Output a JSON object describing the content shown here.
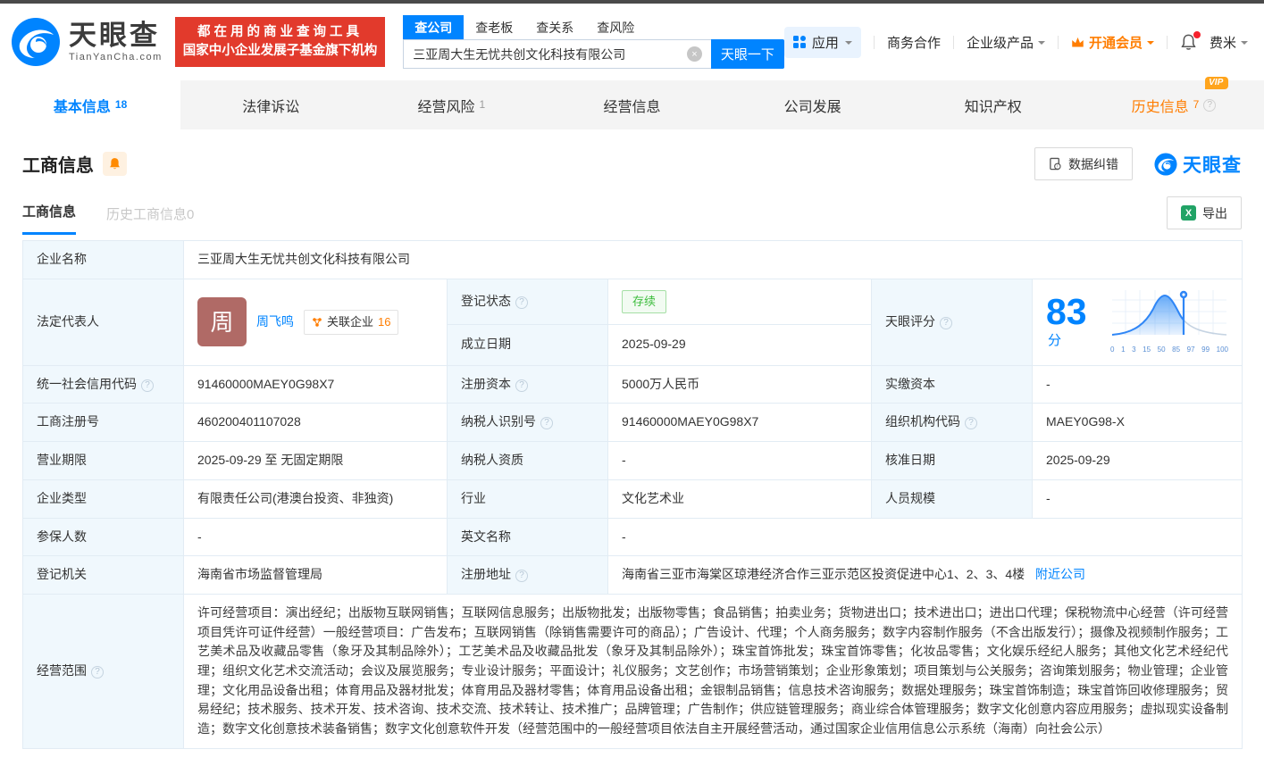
{
  "colors": {
    "primary": "#0084ff",
    "orange": "#ff7d00",
    "red": "#e23a2c",
    "green": "#3dbd3d"
  },
  "header": {
    "logo_title": "天眼查",
    "logo_subtitle": "TianYanCha.com",
    "slogan_line1": "都在用的商业查询工具",
    "slogan_line2": "国家中小企业发展子基金旗下机构",
    "search_tabs": [
      {
        "label": "查公司"
      },
      {
        "label": "查老板"
      },
      {
        "label": "查关系"
      },
      {
        "label": "查风险"
      }
    ],
    "search_value": "三亚周大生无忧共创文化科技有限公司",
    "search_button": "天眼一下",
    "nav_apps": "应用",
    "nav_cooperation": "商务合作",
    "nav_enterprise": "企业级产品",
    "nav_vip": "开通会员",
    "nav_user": "费米"
  },
  "nav_tabs": [
    {
      "label": "基本信息",
      "count": "18"
    },
    {
      "label": "法律诉讼",
      "count": ""
    },
    {
      "label": "经营风险",
      "count": "1"
    },
    {
      "label": "经营信息",
      "count": ""
    },
    {
      "label": "公司发展",
      "count": ""
    },
    {
      "label": "知识产权",
      "count": ""
    },
    {
      "label": "历史信息",
      "count": "7",
      "vip_badge": "VIP"
    }
  ],
  "section": {
    "title": "工商信息",
    "data_correction": "数据纠错",
    "watermark": "天眼查",
    "subtabs": [
      {
        "label": "工商信息"
      },
      {
        "label": "历史工商信息0"
      }
    ],
    "export": "导出"
  },
  "table": {
    "company_name": {
      "label": "企业名称",
      "value": "三亚周大生无忧共创文化科技有限公司"
    },
    "legal_rep": {
      "label": "法定代表人",
      "avatar": "周",
      "name": "周飞鸣",
      "related_label": "关联企业",
      "related_count": "16"
    },
    "reg_status": {
      "label": "登记状态",
      "value": "存续"
    },
    "establish_date": {
      "label": "成立日期",
      "value": "2025-09-29"
    },
    "score": {
      "label": "天眼评分",
      "value": "83",
      "unit": "分",
      "axis": [
        "0",
        "1",
        "3",
        "15",
        "50",
        "85",
        "97",
        "99",
        "100"
      ]
    },
    "credit_code": {
      "label": "统一社会信用代码",
      "value": "91460000MAEY0G98X7"
    },
    "reg_capital": {
      "label": "注册资本",
      "value": "5000万人民币"
    },
    "paid_capital": {
      "label": "实缴资本",
      "value": "-"
    },
    "reg_number": {
      "label": "工商注册号",
      "value": "460200401107028"
    },
    "taxpayer_id": {
      "label": "纳税人识别号",
      "value": "91460000MAEY0G98X7"
    },
    "org_code": {
      "label": "组织机构代码",
      "value": "MAEY0G98-X"
    },
    "business_term": {
      "label": "营业期限",
      "value": "2025-09-29 至 无固定期限"
    },
    "taxpayer_quality": {
      "label": "纳税人资质",
      "value": "-"
    },
    "approval_date": {
      "label": "核准日期",
      "value": "2025-09-29"
    },
    "company_type": {
      "label": "企业类型",
      "value": "有限责任公司(港澳台投资、非独资)"
    },
    "industry": {
      "label": "行业",
      "value": "文化艺术业"
    },
    "staff_size": {
      "label": "人员规模",
      "value": "-"
    },
    "insured_count": {
      "label": "参保人数",
      "value": "-"
    },
    "english_name": {
      "label": "英文名称",
      "value": "-"
    },
    "reg_authority": {
      "label": "登记机关",
      "value": "海南省市场监督管理局"
    },
    "reg_address": {
      "label": "注册地址",
      "value": "海南省三亚市海棠区琼港经济合作三亚示范区投资促进中心1、2、3、4楼",
      "link": "附近公司"
    },
    "business_scope": {
      "label": "经营范围",
      "value": "许可经营项目：演出经纪；出版物互联网销售；互联网信息服务；出版物批发；出版物零售；食品销售；拍卖业务；货物进出口；技术进出口；进出口代理；保税物流中心经营（许可经营项目凭许可证件经营）一般经营项目：广告发布；互联网销售（除销售需要许可的商品）；广告设计、代理；个人商务服务；数字内容制作服务（不含出版发行）；摄像及视频制作服务；工艺美术品及收藏品零售（象牙及其制品除外）；工艺美术品及收藏品批发（象牙及其制品除外）；珠宝首饰批发；珠宝首饰零售；化妆品零售；文化娱乐经纪人服务；其他文化艺术经纪代理；组织文化艺术交流活动；会议及展览服务；专业设计服务；平面设计；礼仪服务；文艺创作；市场营销策划；企业形象策划；项目策划与公关服务；咨询策划服务；物业管理；企业管理；文化用品设备出租；体育用品及器材批发；体育用品及器材零售；体育用品设备出租；金银制品销售；信息技术咨询服务；数据处理服务；珠宝首饰制造；珠宝首饰回收修理服务；贸易经纪；技术服务、技术开发、技术咨询、技术交流、技术转让、技术推广；品牌管理；广告制作；供应链管理服务；商业综合体管理服务；数字文化创意内容应用服务；虚拟现实设备制造；数字文化创意技术装备销售；数字文化创意软件开发（经营范围中的一般经营项目依法自主开展经营活动，通过国家企业信用信息公示系统（海南）向社会公示）"
    }
  }
}
